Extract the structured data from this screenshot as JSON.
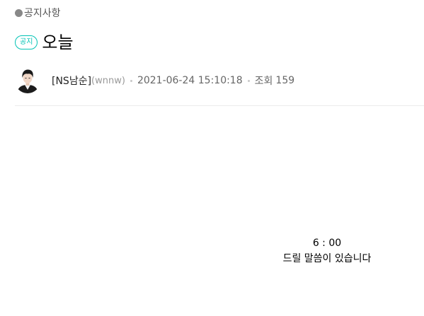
{
  "board": {
    "name": "공지사항"
  },
  "post": {
    "badge": "공지",
    "title": "오늘",
    "author_name": "[NS남순]",
    "author_id": "(wnnw)",
    "date": "2021-06-24 15:10:18",
    "views_label": "조회",
    "views_count": "159",
    "content": [
      "6 : 00",
      "드릴 말씀이 있습니다"
    ]
  },
  "colors": {
    "accent": "#03c3b5",
    "divider": "#ebebeb"
  },
  "icons": {
    "board": "bullet-dot-icon",
    "avatar": "author-avatar"
  }
}
